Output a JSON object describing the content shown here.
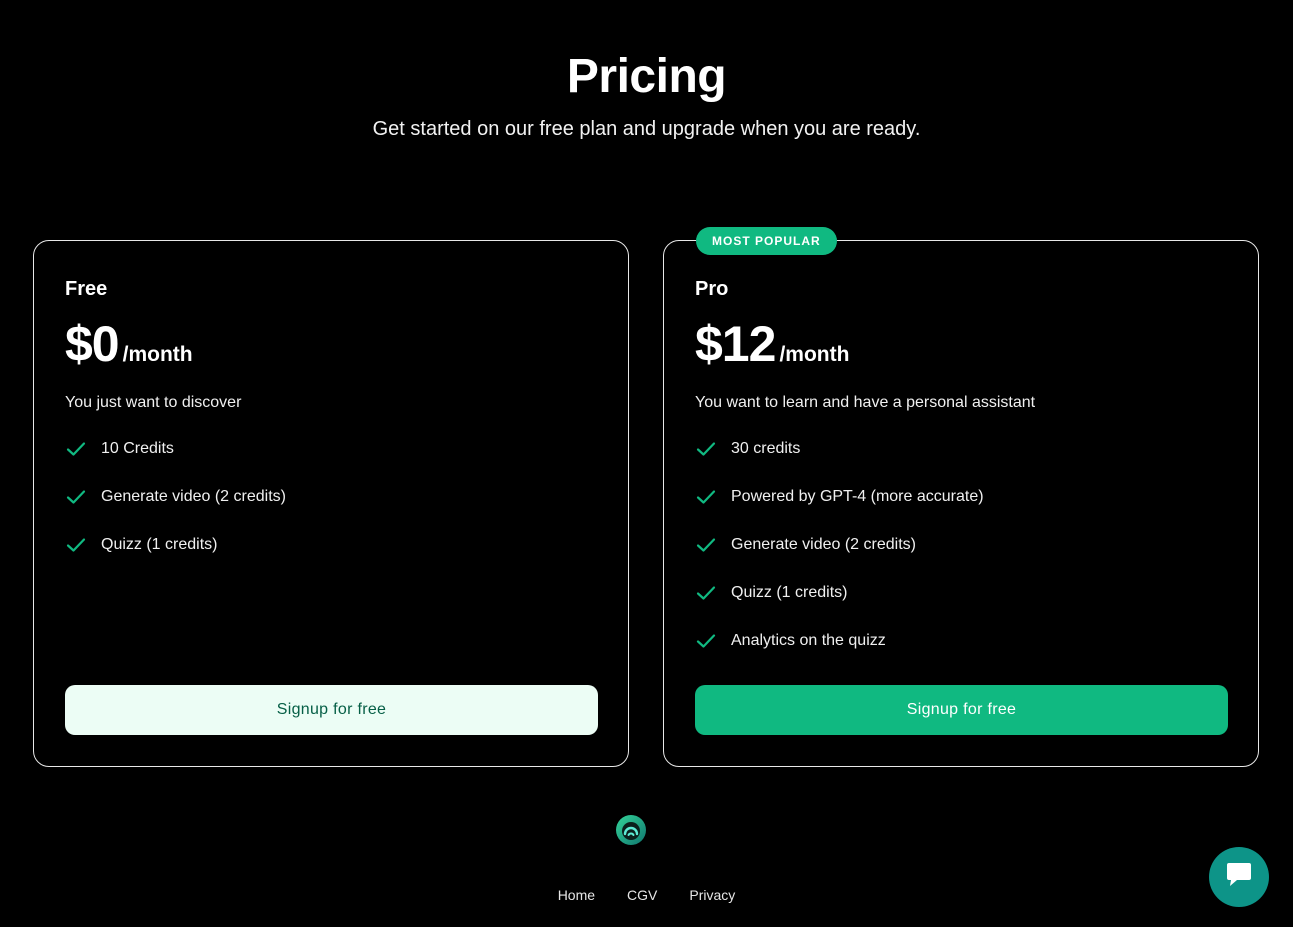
{
  "header": {
    "title": "Pricing",
    "subtitle": "Get started on our free plan and upgrade when you are ready."
  },
  "plans": [
    {
      "name": "Free",
      "price": "$0",
      "period": "/month",
      "description": "You just want to discover",
      "features": [
        "10 Credits",
        "Generate video (2 credits)",
        "Quizz (1 credits)"
      ],
      "cta_label": "Signup for free"
    },
    {
      "badge": "MOST POPULAR",
      "name": "Pro",
      "price": "$12",
      "period": "/month",
      "description": "You want to learn and have a personal assistant",
      "features": [
        "30 credits",
        "Powered by GPT-4 (more accurate)",
        "Generate video (2 credits)",
        "Quizz (1 credits)",
        "Analytics on the quizz"
      ],
      "cta_label": "Signup for free"
    }
  ],
  "footer": {
    "links": [
      "Home",
      "CGV",
      "Privacy"
    ]
  },
  "icons": {
    "check": "check-icon",
    "logo": "brand-logo-icon",
    "chat": "chat-bubble-icon"
  },
  "colors": {
    "background": "#000000",
    "accent": "#10b981",
    "light_button": "#ecfdf5",
    "light_button_text": "#065f46",
    "chat_button": "#0d9488"
  }
}
